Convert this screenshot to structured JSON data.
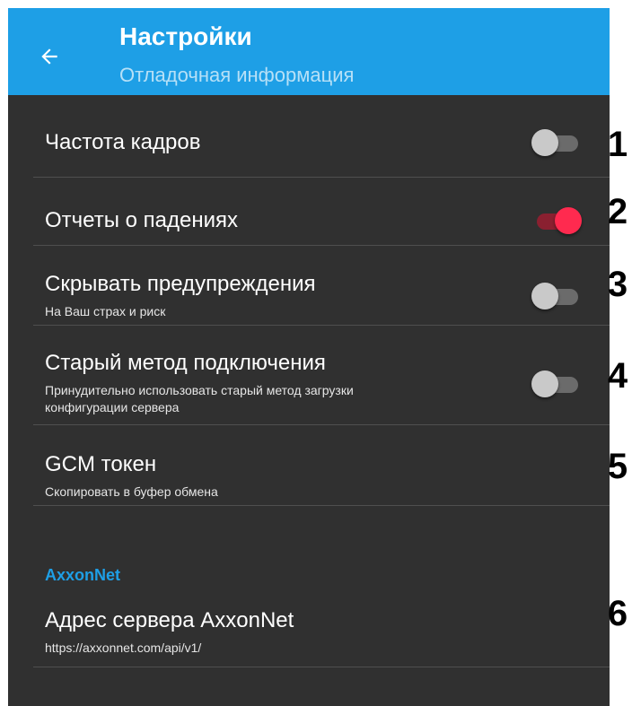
{
  "appbar": {
    "title": "Настройки",
    "subtitle": "Отладочная информация",
    "back_icon": "arrow-left-icon",
    "color": "#1e9fe6"
  },
  "settings": [
    {
      "title": "Частота кадров",
      "summary": "",
      "toggle": false
    },
    {
      "title": "Отчеты о падениях",
      "summary": "",
      "toggle": true
    },
    {
      "title": "Скрывать предупреждения",
      "summary": "На Ваш страх и риск",
      "toggle": false
    },
    {
      "title": "Старый метод подключения",
      "summary_line1": "Принудительно использовать старый метод загрузки",
      "summary_line2": "конфигурации сервера",
      "toggle": false
    },
    {
      "title": "GCM токен",
      "summary": "Скопировать в буфер обмена"
    }
  ],
  "axxonnet": {
    "header": "AxxonNet",
    "server_title": "Адрес сервера AxxonNet",
    "server_value": "https://axxonnet.com/api/v1/"
  },
  "callouts": [
    "1",
    "2",
    "3",
    "4",
    "5",
    "6"
  ],
  "colors": {
    "background": "#303030",
    "accent": "#1e9fe6",
    "switch_on": "#ff2a4f",
    "switch_off": "#c9c9c9"
  }
}
